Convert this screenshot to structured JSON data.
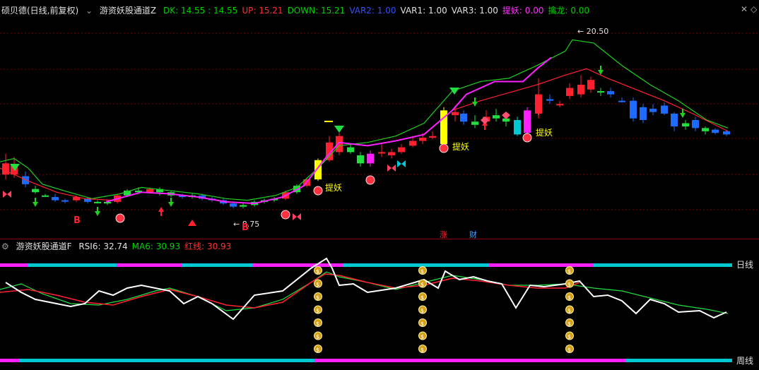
{
  "main": {
    "stock_name": "硕贝德(日线,前复权)",
    "indicator_name": "游资妖股通道Z",
    "values": [
      {
        "label": "DK: 14.55 : 14.55",
        "color": "#00d000"
      },
      {
        "label": "UP: 15.21",
        "color": "#ff3030"
      },
      {
        "label": "DOWN: 15.21",
        "color": "#00d000"
      },
      {
        "label": "VAR2: 1.00",
        "color": "#3050ff"
      },
      {
        "label": "VAR1: 1.00",
        "color": "#e0e0e0"
      },
      {
        "label": "VAR3: 1.00",
        "color": "#e0e0e0"
      },
      {
        "label": "提妖: 0.00",
        "color": "#ff30ff"
      },
      {
        "label": "擒龙: 0.00",
        "color": "#00d000"
      }
    ],
    "annotations": {
      "high_price": "20.50",
      "low_price": "8.75",
      "tiyao_1": "提妖",
      "tiyao_2": "提妖",
      "tiyao_3": "提妖",
      "b_1": "B",
      "b_2": "B",
      "zhang": "涨",
      "cai": "财"
    }
  },
  "lower": {
    "indicator_name": "游资妖股通道F",
    "values": [
      {
        "label": "RSI6: 32.74",
        "color": "#e0e0e0"
      },
      {
        "label": "MA6: 30.93",
        "color": "#00d000"
      },
      {
        "label": "红线: 30.93",
        "color": "#ff3030"
      }
    ],
    "daily_label": "日线",
    "weekly_label": "周线",
    "coin_glyph": "$"
  },
  "colors": {
    "up": "#ff2030",
    "down": "#1e6cff",
    "green": "#20e040",
    "magenta": "#ff20ff",
    "cyan": "#00c8d0",
    "yellow": "#ffff00",
    "gold": "#d4a017"
  }
}
